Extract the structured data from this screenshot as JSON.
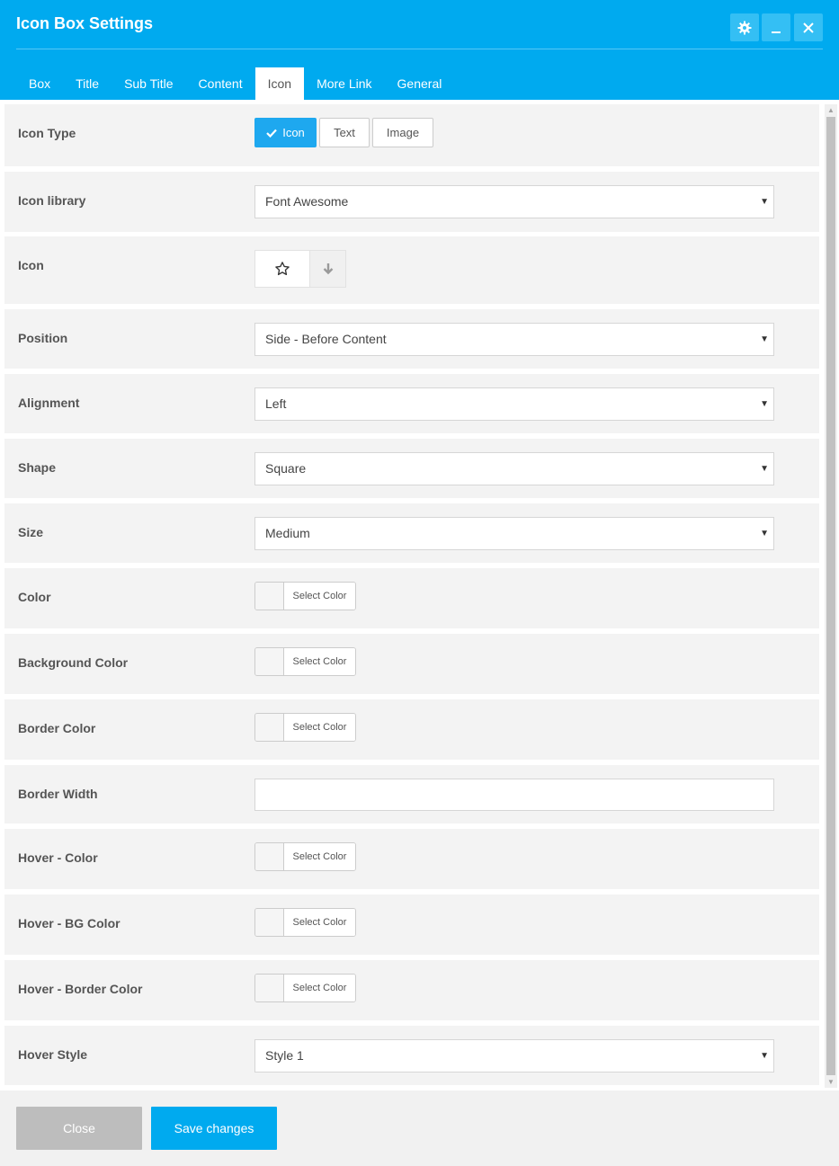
{
  "window": {
    "title": "Icon Box Settings"
  },
  "tabs": [
    "Box",
    "Title",
    "Sub Title",
    "Content",
    "Icon",
    "More Link",
    "General"
  ],
  "active_tab": "Icon",
  "icon_type": {
    "label": "Icon Type",
    "options": [
      "Icon",
      "Text",
      "Image"
    ],
    "selected": "Icon"
  },
  "icon_library": {
    "label": "Icon library",
    "value": "Font Awesome"
  },
  "icon": {
    "label": "Icon",
    "selected_icon": "star-outline-icon"
  },
  "position": {
    "label": "Position",
    "value": "Side - Before Content"
  },
  "alignment": {
    "label": "Alignment",
    "value": "Left"
  },
  "shape": {
    "label": "Shape",
    "value": "Square"
  },
  "size": {
    "label": "Size",
    "value": "Medium"
  },
  "color": {
    "label": "Color",
    "button": "Select Color"
  },
  "background_color": {
    "label": "Background Color",
    "button": "Select Color"
  },
  "border_color": {
    "label": "Border Color",
    "button": "Select Color"
  },
  "border_width": {
    "label": "Border Width",
    "value": ""
  },
  "hover_color": {
    "label": "Hover - Color",
    "button": "Select Color"
  },
  "hover_bg_color": {
    "label": "Hover - BG Color",
    "button": "Select Color"
  },
  "hover_border_color": {
    "label": "Hover - Border Color",
    "button": "Select Color"
  },
  "hover_style": {
    "label": "Hover Style",
    "value": "Style 1"
  },
  "footer": {
    "close_label": "Close",
    "save_label": "Save changes"
  },
  "colors": {
    "accent": "#00aaef",
    "row_bg": "#f3f3f3",
    "close_button": "#bdbdbd"
  }
}
